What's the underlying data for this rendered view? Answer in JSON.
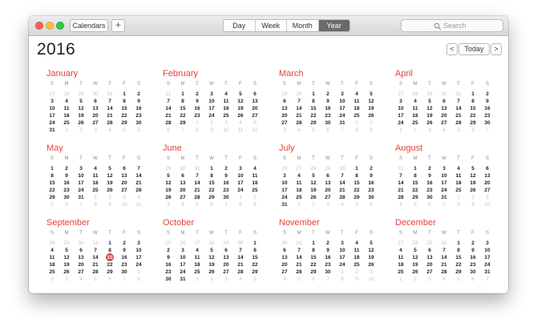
{
  "toolbar": {
    "calendars_label": "Calendars",
    "add_label": "+",
    "views": [
      {
        "label": "Day",
        "active": false
      },
      {
        "label": "Week",
        "active": false
      },
      {
        "label": "Month",
        "active": false
      },
      {
        "label": "Year",
        "active": true
      }
    ],
    "search_placeholder": "Search"
  },
  "header": {
    "year": "2016",
    "prev_label": "<",
    "today_label": "Today",
    "next_label": ">"
  },
  "colors": {
    "accent": "#e2433d",
    "active_segment": "#6a6a6a"
  },
  "weekday_labels": [
    "S",
    "M",
    "T",
    "W",
    "T",
    "F",
    "S"
  ],
  "months": [
    {
      "name": "January",
      "lead": [
        27,
        28,
        29,
        30,
        31
      ],
      "days": 31,
      "trail": [
        1,
        2,
        3,
        4,
        5,
        6
      ]
    },
    {
      "name": "February",
      "lead": [
        31
      ],
      "days": 29,
      "trail": [
        1,
        2,
        3,
        4,
        5,
        6,
        7,
        8,
        9,
        10,
        11,
        12
      ]
    },
    {
      "name": "March",
      "lead": [
        28,
        29
      ],
      "days": 31,
      "trail": [
        1,
        2,
        3,
        4,
        5,
        6,
        7,
        8,
        9
      ]
    },
    {
      "name": "April",
      "lead": [
        27,
        28,
        29,
        30,
        31
      ],
      "days": 30,
      "trail": [
        1,
        2,
        3,
        4,
        5,
        6,
        7
      ]
    },
    {
      "name": "May",
      "lead": [],
      "days": 31,
      "trail": [
        1,
        2,
        3,
        4,
        5,
        6,
        7,
        8,
        9,
        10,
        11
      ]
    },
    {
      "name": "June",
      "lead": [
        29,
        30,
        31
      ],
      "days": 30,
      "trail": [
        1,
        2,
        3,
        4,
        5,
        6,
        7,
        8,
        9
      ]
    },
    {
      "name": "July",
      "lead": [
        26,
        27,
        28,
        29,
        30
      ],
      "days": 31,
      "trail": [
        1,
        2,
        3,
        4,
        5,
        6
      ]
    },
    {
      "name": "August",
      "lead": [
        31
      ],
      "days": 31,
      "trail": [
        1,
        2,
        3,
        4,
        5,
        6,
        7,
        8,
        9,
        10
      ]
    },
    {
      "name": "September",
      "lead": [
        28,
        29,
        30,
        31
      ],
      "days": 30,
      "trail": [
        1,
        2,
        3,
        4,
        5,
        6,
        7,
        8
      ]
    },
    {
      "name": "October",
      "lead": [
        25,
        26,
        27,
        28,
        29,
        30
      ],
      "days": 31,
      "trail": [
        1,
        2,
        3,
        4,
        5
      ]
    },
    {
      "name": "November",
      "lead": [
        30,
        31
      ],
      "days": 30,
      "trail": [
        1,
        2,
        3,
        4,
        5,
        6,
        7,
        8,
        9,
        10
      ]
    },
    {
      "name": "December",
      "lead": [
        27,
        28,
        29,
        30
      ],
      "days": 31,
      "trail": [
        1,
        2,
        3,
        4,
        5,
        6,
        7
      ]
    }
  ],
  "today": {
    "month": "September",
    "day": 15
  }
}
